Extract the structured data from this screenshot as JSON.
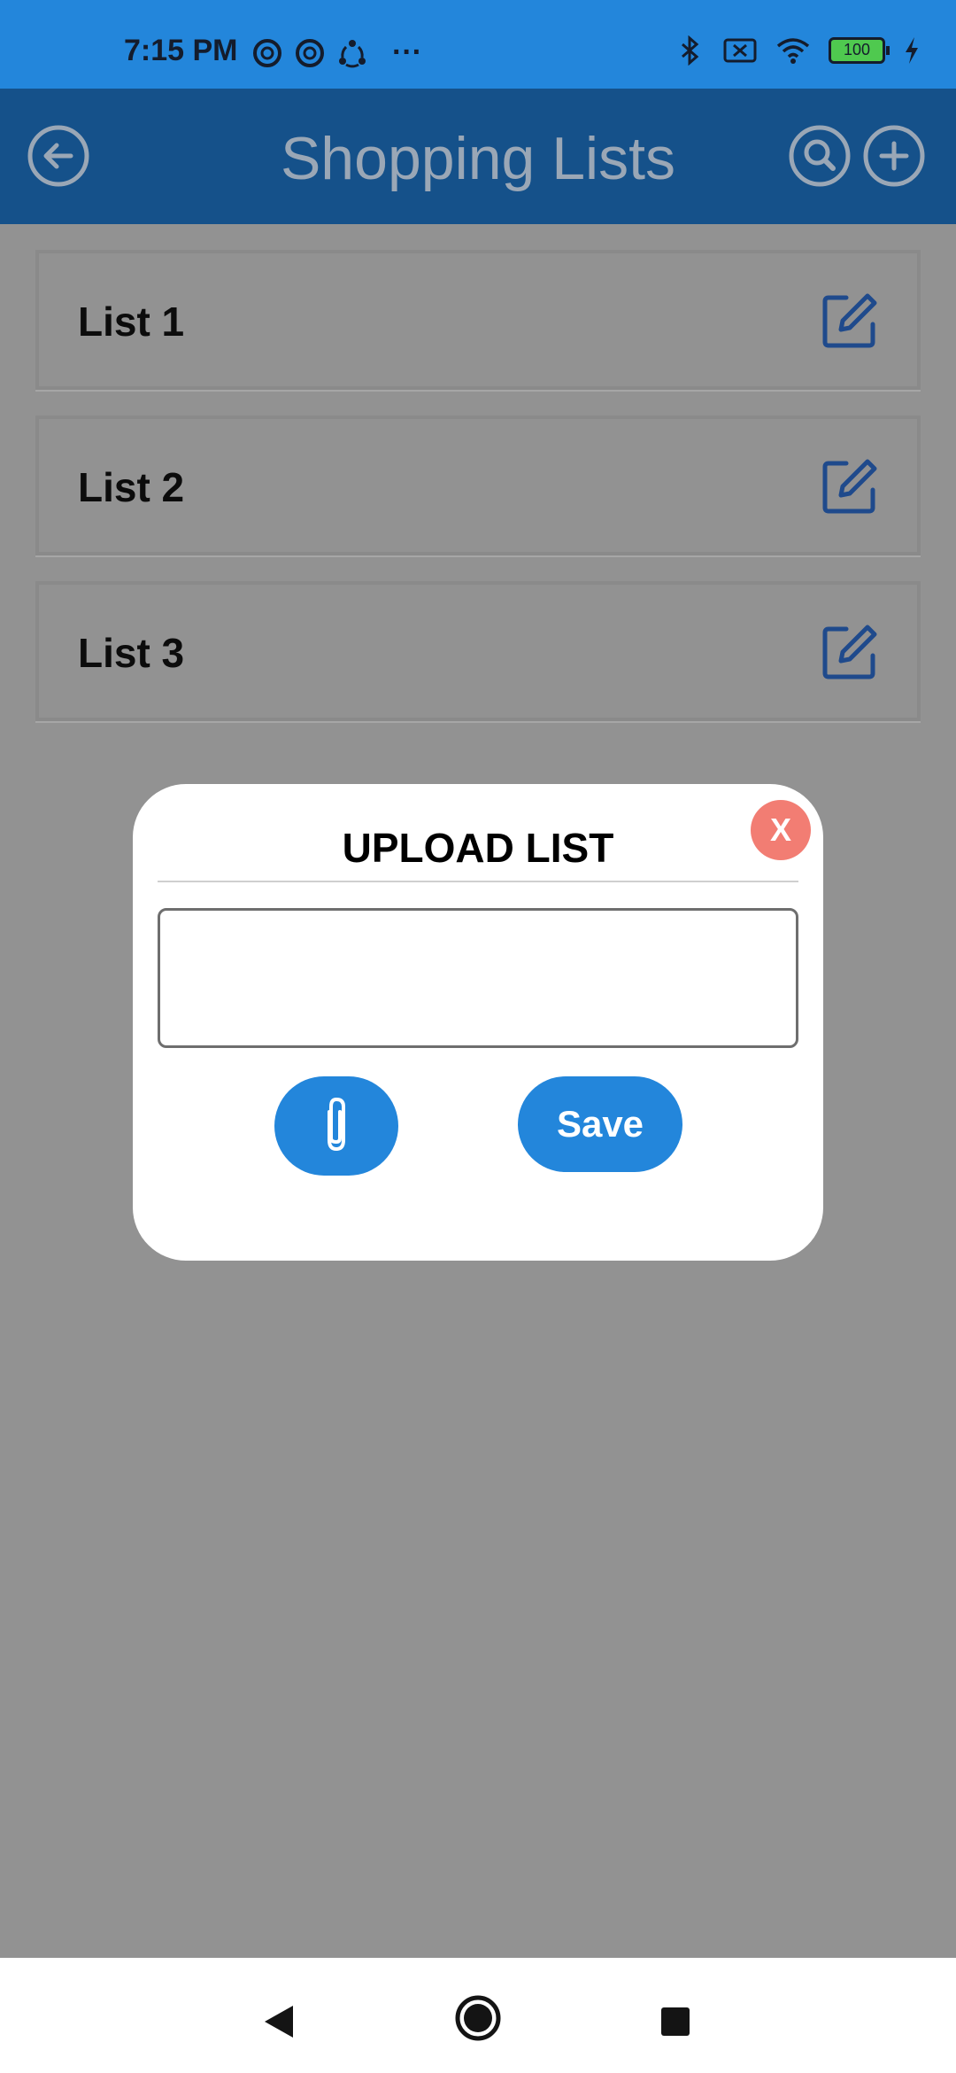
{
  "status_bar": {
    "time": "7:15 PM",
    "dots": "···",
    "battery": "100",
    "icons_left": [
      "app-notification-icon",
      "app-notification-icon",
      "share-icon",
      "more-icon"
    ],
    "icons_right": [
      "bluetooth-icon",
      "no-sim-icon",
      "wifi-icon",
      "battery-icon",
      "charging-icon"
    ]
  },
  "app_bar": {
    "title": "Shopping Lists",
    "icons": [
      "back-arrow-icon",
      "search-icon",
      "add-icon"
    ]
  },
  "lists": [
    {
      "label": "List 1",
      "icon": "edit-icon"
    },
    {
      "label": "List 2",
      "icon": "edit-icon"
    },
    {
      "label": "List 3",
      "icon": "edit-icon"
    }
  ],
  "dialog": {
    "title": "UPLOAD LIST",
    "close_label": "X",
    "input_value": "",
    "input_placeholder": "",
    "attach_icon": "paperclip-icon",
    "save_label": "Save"
  },
  "colors": {
    "status_bar": "#2386db",
    "app_bar": "#15518a",
    "scrim": "#929292",
    "primary_button": "#2386db",
    "close_button": "#f27d73",
    "edit_icon": "#1f4a8c"
  },
  "nav_bar": {
    "icons": [
      "nav-back-icon",
      "nav-home-icon",
      "nav-recents-icon"
    ]
  }
}
